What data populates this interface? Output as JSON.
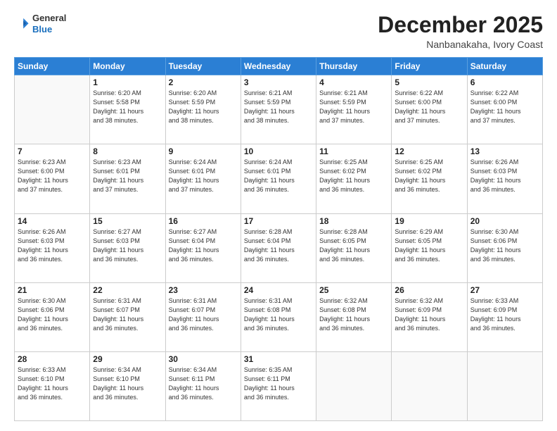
{
  "header": {
    "logo_line1": "General",
    "logo_line2": "Blue",
    "month": "December 2025",
    "location": "Nanbanakaha, Ivory Coast"
  },
  "days_of_week": [
    "Sunday",
    "Monday",
    "Tuesday",
    "Wednesday",
    "Thursday",
    "Friday",
    "Saturday"
  ],
  "weeks": [
    [
      {
        "day": "",
        "info": ""
      },
      {
        "day": "1",
        "info": "Sunrise: 6:20 AM\nSunset: 5:58 PM\nDaylight: 11 hours\nand 38 minutes."
      },
      {
        "day": "2",
        "info": "Sunrise: 6:20 AM\nSunset: 5:59 PM\nDaylight: 11 hours\nand 38 minutes."
      },
      {
        "day": "3",
        "info": "Sunrise: 6:21 AM\nSunset: 5:59 PM\nDaylight: 11 hours\nand 38 minutes."
      },
      {
        "day": "4",
        "info": "Sunrise: 6:21 AM\nSunset: 5:59 PM\nDaylight: 11 hours\nand 37 minutes."
      },
      {
        "day": "5",
        "info": "Sunrise: 6:22 AM\nSunset: 6:00 PM\nDaylight: 11 hours\nand 37 minutes."
      },
      {
        "day": "6",
        "info": "Sunrise: 6:22 AM\nSunset: 6:00 PM\nDaylight: 11 hours\nand 37 minutes."
      }
    ],
    [
      {
        "day": "7",
        "info": "Sunrise: 6:23 AM\nSunset: 6:00 PM\nDaylight: 11 hours\nand 37 minutes."
      },
      {
        "day": "8",
        "info": "Sunrise: 6:23 AM\nSunset: 6:01 PM\nDaylight: 11 hours\nand 37 minutes."
      },
      {
        "day": "9",
        "info": "Sunrise: 6:24 AM\nSunset: 6:01 PM\nDaylight: 11 hours\nand 37 minutes."
      },
      {
        "day": "10",
        "info": "Sunrise: 6:24 AM\nSunset: 6:01 PM\nDaylight: 11 hours\nand 36 minutes."
      },
      {
        "day": "11",
        "info": "Sunrise: 6:25 AM\nSunset: 6:02 PM\nDaylight: 11 hours\nand 36 minutes."
      },
      {
        "day": "12",
        "info": "Sunrise: 6:25 AM\nSunset: 6:02 PM\nDaylight: 11 hours\nand 36 minutes."
      },
      {
        "day": "13",
        "info": "Sunrise: 6:26 AM\nSunset: 6:03 PM\nDaylight: 11 hours\nand 36 minutes."
      }
    ],
    [
      {
        "day": "14",
        "info": "Sunrise: 6:26 AM\nSunset: 6:03 PM\nDaylight: 11 hours\nand 36 minutes."
      },
      {
        "day": "15",
        "info": "Sunrise: 6:27 AM\nSunset: 6:03 PM\nDaylight: 11 hours\nand 36 minutes."
      },
      {
        "day": "16",
        "info": "Sunrise: 6:27 AM\nSunset: 6:04 PM\nDaylight: 11 hours\nand 36 minutes."
      },
      {
        "day": "17",
        "info": "Sunrise: 6:28 AM\nSunset: 6:04 PM\nDaylight: 11 hours\nand 36 minutes."
      },
      {
        "day": "18",
        "info": "Sunrise: 6:28 AM\nSunset: 6:05 PM\nDaylight: 11 hours\nand 36 minutes."
      },
      {
        "day": "19",
        "info": "Sunrise: 6:29 AM\nSunset: 6:05 PM\nDaylight: 11 hours\nand 36 minutes."
      },
      {
        "day": "20",
        "info": "Sunrise: 6:30 AM\nSunset: 6:06 PM\nDaylight: 11 hours\nand 36 minutes."
      }
    ],
    [
      {
        "day": "21",
        "info": "Sunrise: 6:30 AM\nSunset: 6:06 PM\nDaylight: 11 hours\nand 36 minutes."
      },
      {
        "day": "22",
        "info": "Sunrise: 6:31 AM\nSunset: 6:07 PM\nDaylight: 11 hours\nand 36 minutes."
      },
      {
        "day": "23",
        "info": "Sunrise: 6:31 AM\nSunset: 6:07 PM\nDaylight: 11 hours\nand 36 minutes."
      },
      {
        "day": "24",
        "info": "Sunrise: 6:31 AM\nSunset: 6:08 PM\nDaylight: 11 hours\nand 36 minutes."
      },
      {
        "day": "25",
        "info": "Sunrise: 6:32 AM\nSunset: 6:08 PM\nDaylight: 11 hours\nand 36 minutes."
      },
      {
        "day": "26",
        "info": "Sunrise: 6:32 AM\nSunset: 6:09 PM\nDaylight: 11 hours\nand 36 minutes."
      },
      {
        "day": "27",
        "info": "Sunrise: 6:33 AM\nSunset: 6:09 PM\nDaylight: 11 hours\nand 36 minutes."
      }
    ],
    [
      {
        "day": "28",
        "info": "Sunrise: 6:33 AM\nSunset: 6:10 PM\nDaylight: 11 hours\nand 36 minutes."
      },
      {
        "day": "29",
        "info": "Sunrise: 6:34 AM\nSunset: 6:10 PM\nDaylight: 11 hours\nand 36 minutes."
      },
      {
        "day": "30",
        "info": "Sunrise: 6:34 AM\nSunset: 6:11 PM\nDaylight: 11 hours\nand 36 minutes."
      },
      {
        "day": "31",
        "info": "Sunrise: 6:35 AM\nSunset: 6:11 PM\nDaylight: 11 hours\nand 36 minutes."
      },
      {
        "day": "",
        "info": ""
      },
      {
        "day": "",
        "info": ""
      },
      {
        "day": "",
        "info": ""
      }
    ]
  ]
}
